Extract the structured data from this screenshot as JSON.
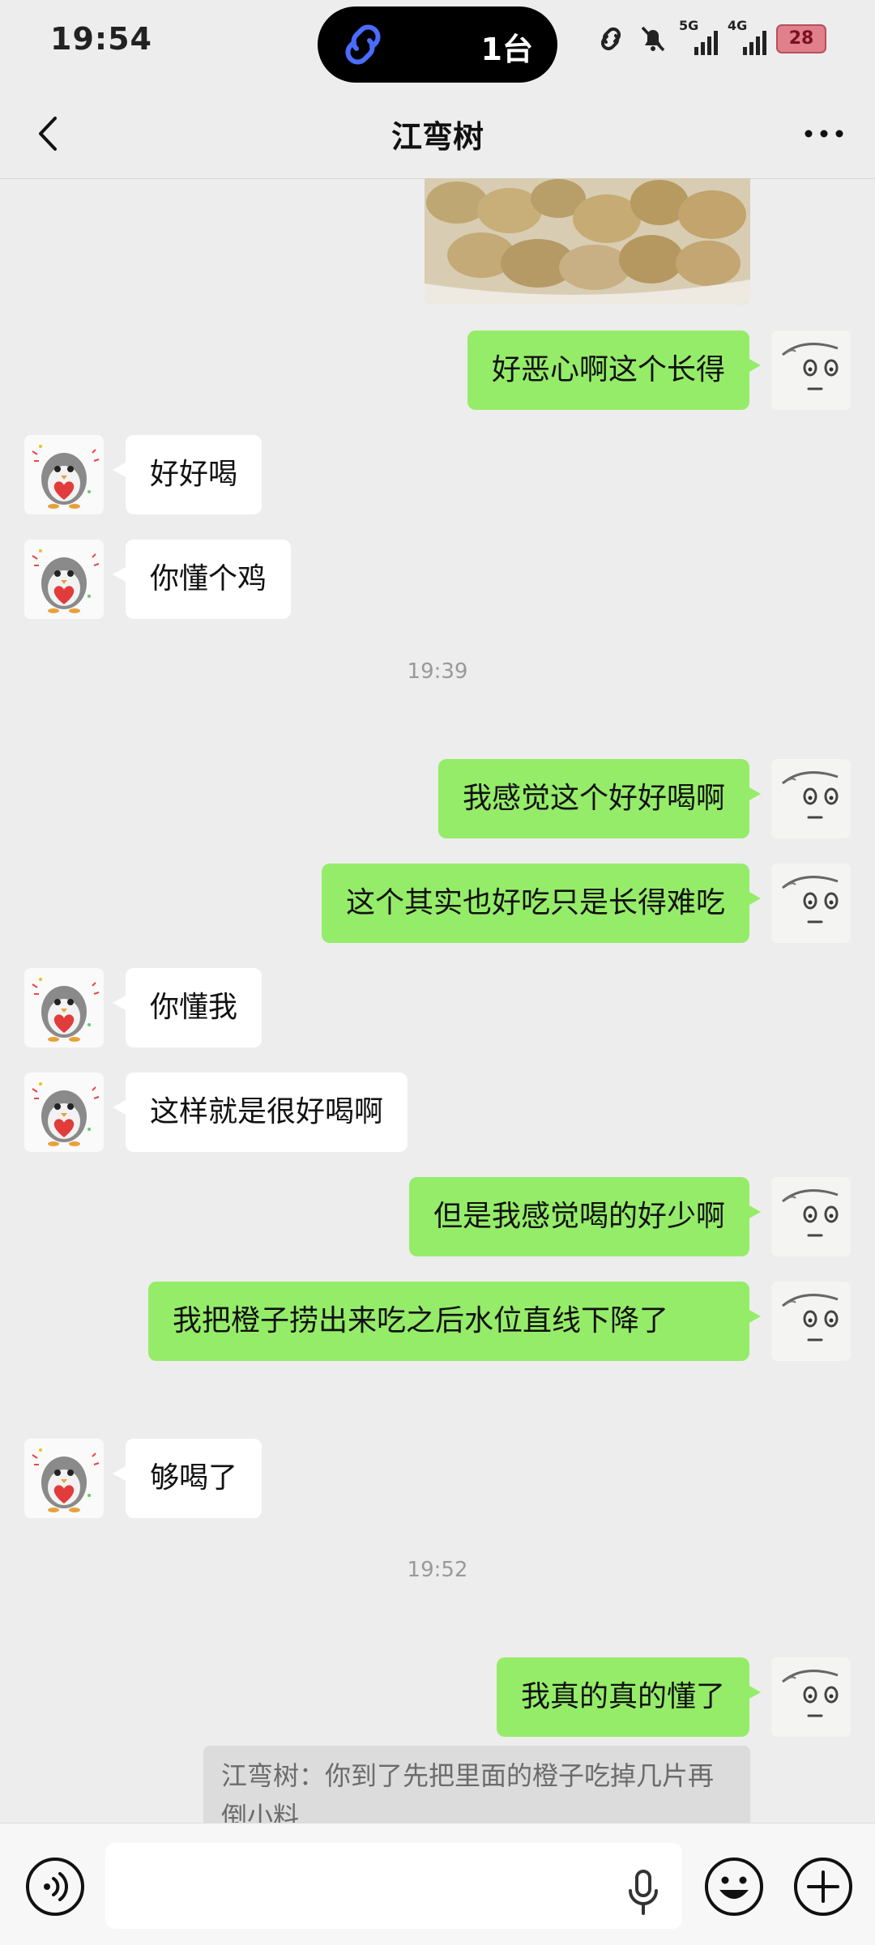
{
  "status_bar": {
    "time": "19:54",
    "island_count": "1台",
    "signal_1_label": "5G",
    "signal_2_label": "4G",
    "battery": "28"
  },
  "header": {
    "title": "江弯树"
  },
  "messages": [
    {
      "side": "me",
      "text": "好恶心啊这个长得"
    },
    {
      "side": "other",
      "text": "好好喝"
    },
    {
      "side": "other",
      "text": "你懂个鸡"
    },
    {
      "side": "time",
      "text": "19:39"
    },
    {
      "side": "me",
      "text": "我感觉这个好好喝啊"
    },
    {
      "side": "me",
      "text": "这个其实也好吃只是长得难吃"
    },
    {
      "side": "other",
      "text": "你懂我"
    },
    {
      "side": "other",
      "text": "这样就是很好喝啊"
    },
    {
      "side": "me",
      "text": "但是我感觉喝的好少啊"
    },
    {
      "side": "me",
      "text": "我把橙子捞出来吃之后水位直线下降了"
    },
    {
      "side": "other",
      "text": "够喝了"
    },
    {
      "side": "time",
      "text": "19:52"
    },
    {
      "side": "me",
      "text": "我真的真的懂了"
    }
  ],
  "quote": {
    "text": "江弯树：你到了先把里面的橙子吃掉几片再倒小料"
  },
  "input_bar": {
    "placeholder": ""
  },
  "colors": {
    "background": "#ededed",
    "my_bubble": "#95ec69",
    "other_bubble": "#ffffff"
  }
}
